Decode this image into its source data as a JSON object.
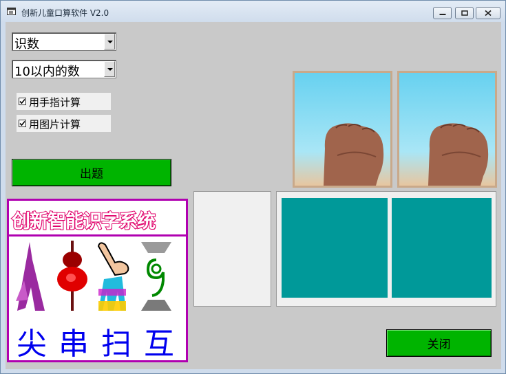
{
  "window": {
    "title": "创新儿童口算软件 V2.0"
  },
  "mode_combo": {
    "value": "识数"
  },
  "range_combo": {
    "value": "10以内的数"
  },
  "options": {
    "finger_label": "用手指计算",
    "finger_checked": true,
    "picture_label": "用图片计算",
    "picture_checked": true
  },
  "question_button": {
    "label": "出题"
  },
  "close_button": {
    "label": "关闭"
  },
  "char_panel": {
    "banner": "创新智能识字系统",
    "characters": [
      "尖",
      "串",
      "扫",
      "互"
    ],
    "pictures": [
      "pointed-figure-icon",
      "skewer-icon",
      "hand-sweep-icon",
      "number-nine-icon"
    ]
  },
  "colors": {
    "green_button": "#00b400",
    "teal_answer": "#009999",
    "magenta_border": "#b000b0",
    "hanzi_blue": "#0000ee"
  }
}
